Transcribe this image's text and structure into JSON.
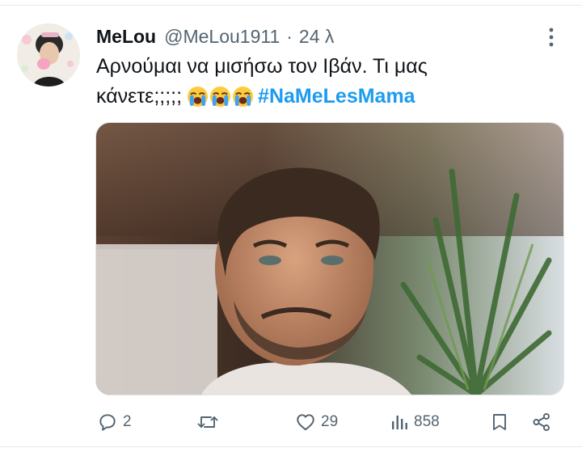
{
  "tweet": {
    "author_name": "MeLou",
    "handle": "@MeLou1911",
    "separator": "·",
    "time": "24 λ",
    "text_line1": "Αρνούμαι να μισήσω τον  Ιβάν. Τι μας",
    "text_line2": "κάνετε;;;;;",
    "emojis": [
      "loudly-crying-face",
      "loudly-crying-face",
      "loudly-crying-face"
    ],
    "hashtag": "#NaMeLesMama"
  },
  "actions": {
    "replies": "2",
    "retweets": "",
    "likes": "29",
    "views": "858"
  },
  "colors": {
    "text": "#0f1419",
    "secondary": "#536471",
    "link": "#1d9bf0",
    "divider": "#e6e9ec"
  },
  "icons": [
    "more-vertical-icon",
    "reply-icon",
    "retweet-icon",
    "like-icon",
    "views-icon",
    "bookmark-icon",
    "share-icon"
  ]
}
